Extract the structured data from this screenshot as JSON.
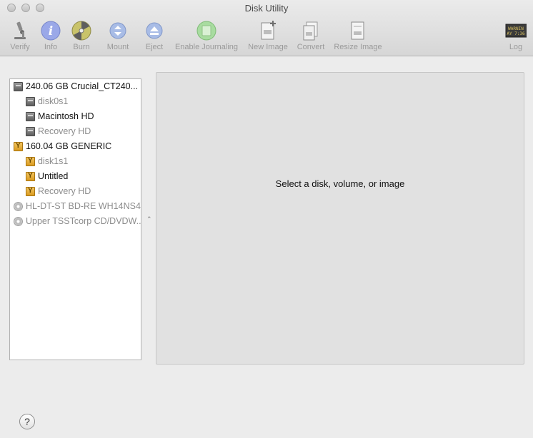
{
  "window": {
    "title": "Disk Utility"
  },
  "toolbar": {
    "verify": "Verify",
    "info": "Info",
    "burn": "Burn",
    "mount": "Mount",
    "eject": "Eject",
    "enable_journaling": "Enable Journaling",
    "new_image": "New Image",
    "convert": "Convert",
    "resize_image": "Resize Image",
    "log": "Log",
    "log_icon_text": "WARNIN\nAY 7:36"
  },
  "sidebar": {
    "items": [
      {
        "label": "240.06 GB Crucial_CT240...",
        "icon": "internal-disk-icon",
        "level": 0,
        "dim": false
      },
      {
        "label": "disk0s1",
        "icon": "internal-disk-icon",
        "level": 1,
        "dim": true
      },
      {
        "label": "Macintosh HD",
        "icon": "internal-disk-icon",
        "level": 1,
        "dim": false
      },
      {
        "label": "Recovery HD",
        "icon": "internal-disk-icon",
        "level": 1,
        "dim": true
      },
      {
        "label": "160.04 GB GENERIC",
        "icon": "usb-disk-icon",
        "level": 0,
        "dim": false
      },
      {
        "label": "disk1s1",
        "icon": "usb-disk-icon",
        "level": 1,
        "dim": true
      },
      {
        "label": "Untitled",
        "icon": "usb-disk-icon",
        "level": 1,
        "dim": false
      },
      {
        "label": "Recovery HD",
        "icon": "usb-disk-icon",
        "level": 1,
        "dim": true
      },
      {
        "label": "HL-DT-ST BD-RE WH14NS4",
        "icon": "optical-drive-icon",
        "level": 0,
        "dim": true
      },
      {
        "label": "Upper TSSTcorp CD/DVDW...",
        "icon": "optical-drive-icon",
        "level": 0,
        "dim": true
      }
    ]
  },
  "detail": {
    "message": "Select a disk, volume, or image"
  },
  "help": {
    "label": "?"
  }
}
